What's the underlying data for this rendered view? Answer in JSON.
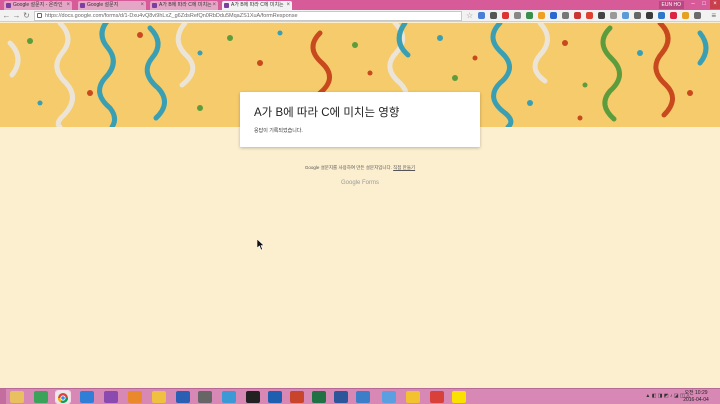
{
  "browser": {
    "tabs": [
      {
        "label": "Google 설문지 - 온라인",
        "active": false
      },
      {
        "label": "Google 설문지",
        "active": false
      },
      {
        "label": "A가 B에 따라 C에 미치는",
        "active": false
      },
      {
        "label": "A가 B에 따라 C에 미치는",
        "active": true
      }
    ],
    "user_badge": "EUN HO",
    "url": "https://docs.google.com/forms/d/1-Dxu4vQ8vi9hLxZ_g6ZdsRefQn0RbDdu5MqaZS1XuA/formResponse",
    "accent_color": "#d65b98"
  },
  "form": {
    "title": "A가 B에 따라 C에 미치는 영향",
    "confirmation": "응답이 기록되었습니다.",
    "footer_text": "Google 설문지를 사용하여 만든 설문지입니다.",
    "footer_link": "직접 만들기",
    "logo_google": "Google",
    "logo_forms": "Forms",
    "banner_color": "#f5cb6b",
    "background_color": "#fcefd0"
  },
  "taskbar": {
    "icons": [
      "folder-icon",
      "drive-icon",
      "chrome-icon",
      "ie-icon",
      "firefox-icon",
      "emoji-app-icon",
      "media-icon",
      "monitor-icon",
      "game-icon",
      "camera-icon",
      "screen-icon",
      "outlook-icon",
      "powerpoint-icon",
      "excel-icon",
      "word-icon",
      "tool-icon",
      "cloud-icon",
      "star-icon",
      "hangul-icon",
      "kakaotalk-icon"
    ],
    "clock_period": "오전 10:29",
    "date": "2016-04-04"
  }
}
